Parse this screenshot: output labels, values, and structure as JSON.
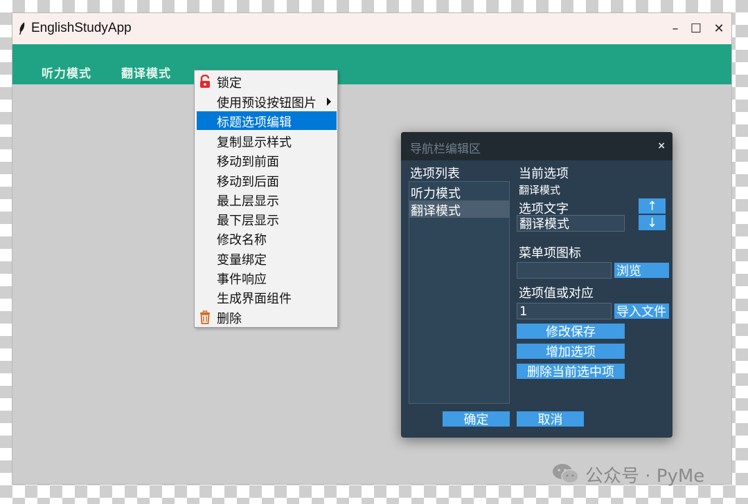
{
  "window": {
    "title": "EnglishStudyApp",
    "controls": {
      "minimize": "–",
      "maximize": "☐",
      "close": "✕"
    }
  },
  "navbar": {
    "items": [
      {
        "label": "听力模式"
      },
      {
        "label": "翻译模式"
      }
    ]
  },
  "context_menu": {
    "items": [
      {
        "label": "锁定",
        "icon": "unlock-icon"
      },
      {
        "label": "使用预设按钮图片",
        "submenu": true
      },
      {
        "label": "标题选项编辑",
        "selected": true
      },
      {
        "label": "复制显示样式"
      },
      {
        "label": "移动到前面"
      },
      {
        "label": "移动到后面"
      },
      {
        "label": "最上层显示"
      },
      {
        "label": "最下层显示"
      },
      {
        "label": "修改名称"
      },
      {
        "label": "变量绑定"
      },
      {
        "label": "事件响应"
      },
      {
        "label": "生成界面组件"
      },
      {
        "label": "删除",
        "icon": "trash-icon"
      }
    ]
  },
  "dialog": {
    "title": "导航栏编辑区",
    "close": "×",
    "list_heading": "选项列表",
    "list_items": [
      "听力模式",
      "翻译模式"
    ],
    "selected_index": 1,
    "current_heading": "当前选项",
    "current_value": "翻译模式",
    "option_text_label": "选项文字",
    "option_text_value": "翻译模式",
    "move_up": "↑",
    "move_down": "↓",
    "icon_label": "菜单项图标",
    "icon_value": "",
    "browse_button": "浏览",
    "value_label": "选项值或对应",
    "value_input": "1",
    "import_button": "导入文件",
    "save_button": "修改保存",
    "add_button": "增加选项",
    "delete_button": "删除当前选中项",
    "ok_button": "确定",
    "cancel_button": "取消"
  },
  "watermark": {
    "text": "公众号 · PyMe"
  },
  "colors": {
    "navbar": "#1fa384",
    "menu_highlight": "#0078d7",
    "dialog_bg": "#2b3e50",
    "button": "#3f9ce5"
  }
}
